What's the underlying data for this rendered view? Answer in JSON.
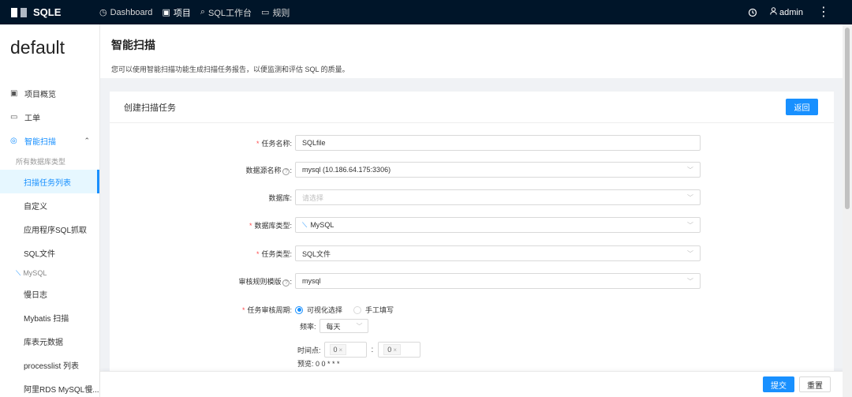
{
  "brand": {
    "name": "SQLE"
  },
  "nav": [
    {
      "icon": "◷",
      "label": "Dashboard"
    },
    {
      "icon": "▣",
      "label": "项目"
    },
    {
      "icon": "⌕",
      "label": "SQL工作台"
    },
    {
      "icon": "▭",
      "label": "规则"
    }
  ],
  "user": {
    "name": "admin"
  },
  "sidebar": {
    "project": "default",
    "items": [
      {
        "icon": "▣",
        "label": "项目概览"
      },
      {
        "icon": "▭",
        "label": "工单"
      },
      {
        "icon": "◎",
        "label": "智能扫描"
      }
    ],
    "group_all": "所有数据库类型",
    "sub_all": [
      "扫描任务列表",
      "自定义",
      "应用程序SQL抓取",
      "SQL文件"
    ],
    "group_mysql": "MySQL",
    "sub_mysql": [
      "慢日志",
      "Mybatis 扫描",
      "库表元数据",
      "processlist 列表",
      "阿里RDS MySQL慢..."
    ]
  },
  "page": {
    "title": "智能扫描",
    "desc": "您可以使用智能扫描功能生成扫描任务报告，以便监测和评估 SQL 的质量。"
  },
  "card": {
    "title": "创建扫描任务",
    "back": "返回"
  },
  "form": {
    "task_name": {
      "label": "任务名称:",
      "value": "SQLfile"
    },
    "datasource": {
      "label": "数据源名称",
      "value": "mysql (10.186.64.175:3306)"
    },
    "database": {
      "label": "数据库:",
      "placeholder": "请选择"
    },
    "db_type": {
      "label": "数据库类型:",
      "value": "MySQL"
    },
    "task_type": {
      "label": "任务类型:",
      "value": "SQL文件"
    },
    "rule_template": {
      "label": "审核规则模版",
      "value": "mysql"
    },
    "cycle": {
      "label": "任务审核周期:",
      "opt1": "可视化选择",
      "opt2": "手工填写"
    },
    "freq": {
      "label": "频率:",
      "value": "每天"
    },
    "time": {
      "label": "时间点:",
      "hour": "0",
      "minute": "0"
    },
    "preview": {
      "text": "预览: 0 0 * * *"
    }
  },
  "footer": {
    "submit": "提交",
    "reset": "重置"
  },
  "colors": {
    "primary": "#1890ff",
    "topbar": "#001529"
  }
}
